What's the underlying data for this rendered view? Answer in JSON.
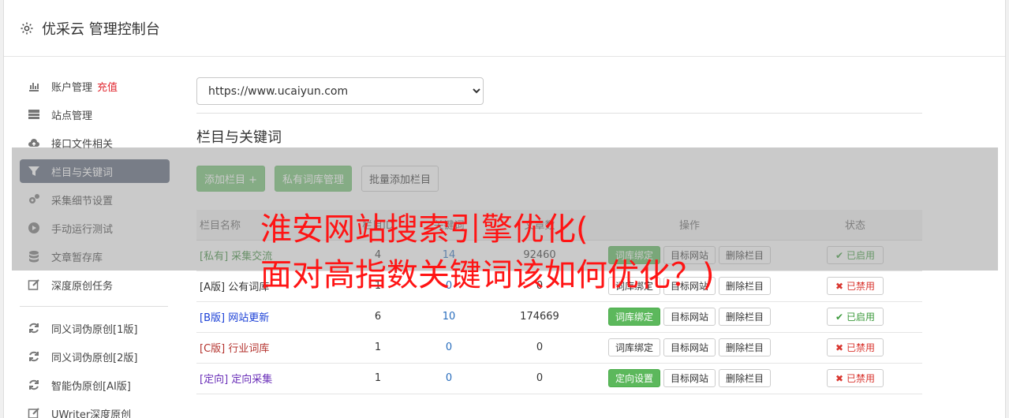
{
  "header": {
    "title": "优采云 管理控制台"
  },
  "sidebar": {
    "items": [
      {
        "label": "账户管理",
        "extra": "充值",
        "icon": "bar-chart-icon"
      },
      {
        "label": "站点管理",
        "icon": "server-icon"
      },
      {
        "label": "接口文件相关",
        "icon": "cloud-upload-icon"
      },
      {
        "label": "栏目与关键词",
        "icon": "filter-icon"
      },
      {
        "label": "采集细节设置",
        "icon": "gears-icon"
      },
      {
        "label": "手动运行测试",
        "icon": "play-icon"
      },
      {
        "label": "文章暂存库",
        "icon": "database-icon"
      },
      {
        "label": "深度原创任务",
        "icon": "edit-icon"
      }
    ],
    "items2": [
      {
        "label": "同义词伪原创[1版]",
        "icon": "refresh-icon"
      },
      {
        "label": "同义词伪原创[2版]",
        "icon": "refresh-icon"
      },
      {
        "label": "智能伪原创[AI版]",
        "icon": "refresh-icon"
      },
      {
        "label": "UWriter深度原创",
        "icon": "edit-icon"
      }
    ]
  },
  "main": {
    "site_select": "https://www.ucaiyun.com",
    "section_title": "栏目与关键词",
    "buttons": {
      "add_column": "添加栏目 +",
      "private_lib": "私有词库管理",
      "batch_add": "批量添加栏目"
    },
    "table": {
      "headers": [
        "栏目名称",
        "栏目ID",
        "关键词",
        "文章数",
        "操作",
        "状态"
      ],
      "rows": [
        {
          "tag": "[私有]",
          "name": "采集交流",
          "a": "4",
          "b": "14",
          "c": "92460",
          "op1": "词库绑定",
          "op2": "目标网站",
          "op3": "删除栏目",
          "state": "已启用",
          "on": true,
          "color": "#3c8a3c",
          "op1green": true
        },
        {
          "tag": "[A版]",
          "name": "公有词库",
          "a": "1",
          "b": "0",
          "c": "0",
          "op1": "词库绑定",
          "op2": "目标网站",
          "op3": "删除栏目",
          "state": "已禁用",
          "on": false,
          "color": "#333333",
          "op1green": false
        },
        {
          "tag": "[B版]",
          "name": "网站更新",
          "a": "6",
          "b": "10",
          "c": "174669",
          "op1": "词库绑定",
          "op2": "目标网站",
          "op3": "删除栏目",
          "state": "已启用",
          "on": true,
          "color": "#1a3fd6",
          "op1green": true
        },
        {
          "tag": "[C版]",
          "name": "行业词库",
          "a": "1",
          "b": "0",
          "c": "0",
          "op1": "词库绑定",
          "op2": "目标网站",
          "op3": "删除栏目",
          "state": "已禁用",
          "on": false,
          "color": "#b4332e",
          "op1green": false
        },
        {
          "tag": "[定向]",
          "name": "定向采集",
          "a": "1",
          "b": "0",
          "c": "0",
          "op1": "定向设置",
          "op2": "目标网站",
          "op3": "删除栏目",
          "state": "已禁用",
          "on": false,
          "color": "#6a2fb8",
          "op1green": true
        }
      ]
    }
  },
  "overlay_text": "淮安网站搜索引擎优化(\n面对高指数关键词该如何优化？)"
}
